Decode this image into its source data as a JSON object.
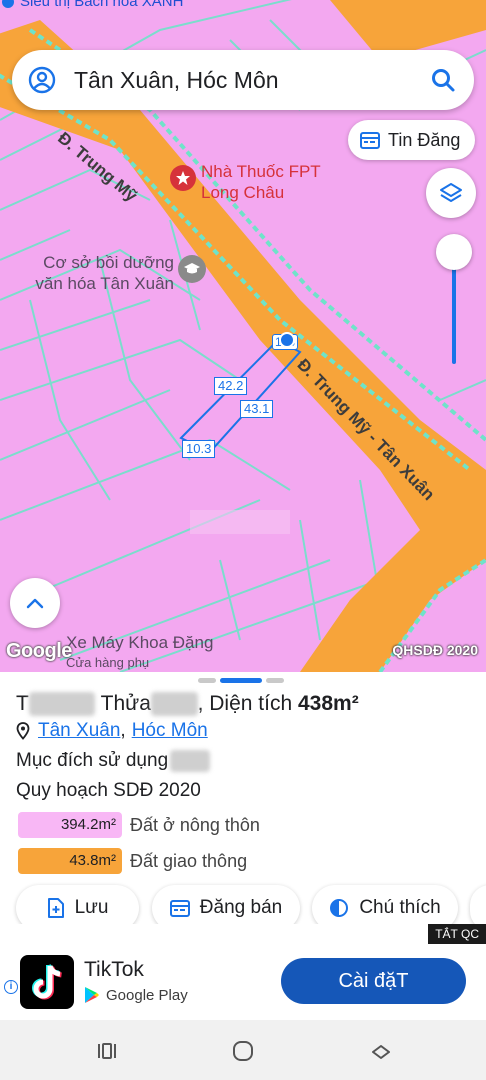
{
  "map": {
    "top_poi": "Siêu thị Bách hóa XANH",
    "search_query": "Tân Xuân, Hóc Môn",
    "tin_dang_label": "Tin Đăng",
    "road_label_1": "Đ. Trung Mỹ",
    "road_label_2": "Đ. Trung Mỹ - Tân Xuân",
    "poi_pharmacy": "Nhà Thuốc FPT Long Châu",
    "poi_school_line1": "Cơ sở bồi dưỡng",
    "poi_school_line2": "văn hóa Tân Xuân",
    "poi_moto": "Xe Máy Khoa Đặng",
    "poi_moto_sub": "Cửa hàng phụ",
    "lot_number": "103",
    "measure_1": "42.2",
    "measure_2": "43.1",
    "measure_3": "10.3",
    "attribution": "Google",
    "layer_badge": "QHSDĐ 2020",
    "colors": {
      "residential": "#f3a8f0",
      "road": "#f7a43a",
      "boundary": "#6fe3c9"
    }
  },
  "sheet": {
    "title_prefix": "T",
    "title_thua": "Thửa",
    "title_area_label": ", Diện tích ",
    "title_area_value": "438m²",
    "address_part1": "Tân Xuân",
    "address_part2": "Hóc Môn",
    "purpose_label": "Mục đích sử dụng",
    "plan_label": "Quy hoạch SDĐ 2020",
    "legend": [
      {
        "value": "394.2m²",
        "label": "Đất ở nông thôn",
        "color": "#f8b7f5"
      },
      {
        "value": "43.8m²",
        "label": "Đất giao thông",
        "color": "#f7a43a"
      }
    ],
    "actions": {
      "save": "Lưu",
      "sell": "Đăng bán",
      "legend": "Chú thích"
    }
  },
  "ad": {
    "close_label": "TẮT QC",
    "app_name": "TikTok",
    "store": "Google Play",
    "install": "Cài đặT",
    "info_glyph": "i"
  }
}
